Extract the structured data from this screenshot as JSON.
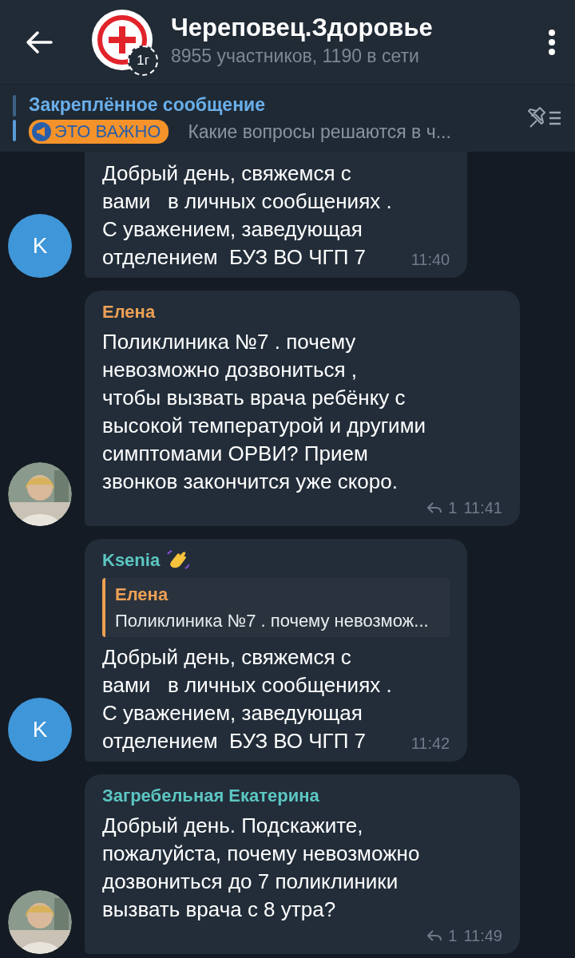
{
  "header": {
    "title": "Череповец.Здоровье",
    "subtitle": "8955 участников, 1190 в сети",
    "avatar_badge": "1г"
  },
  "pinned": {
    "label": "Закреплённое сообщение",
    "tag": "ЭТО ВАЖНО",
    "text": "Какие вопросы решаются в ч..."
  },
  "messages": [
    {
      "text": "Добрый день, свяжемся с\nвами   в личных сообщениях .\nС уважением, заведующая\nотделением  БУЗ ВО ЧГП 7",
      "time": "11:40",
      "avatar": {
        "kind": "letter",
        "letter": "K",
        "color": "#3f96d8"
      }
    },
    {
      "author": "Елена",
      "color": "#eea055",
      "text": "Поликлиника №7 . почему\nневозможно дозвониться ,\nчтобы вызвать врача ребёнку с\nвысокой температурой и другими\nсимптомами ОРВИ? Прием\nзвонков закончится уже скоро.",
      "replies": "1",
      "time": "11:41"
    },
    {
      "author": "Ksenia",
      "color": "#5cc6c2",
      "emoji_status": true,
      "quote": {
        "author": "Елена",
        "text": "Поликлиника №7 . почему невозмож...",
        "color": "#eea055"
      },
      "text": "Добрый день, свяжемся с\nвами   в личных сообщениях .\nС уважением, заведующая\nотделением  БУЗ ВО ЧГП 7",
      "time": "11:42",
      "avatar": {
        "kind": "letter",
        "letter": "K",
        "color": "#3f96d8"
      }
    },
    {
      "author": "Загребельная Екатерина",
      "color": "#5cc6c2",
      "text": "Добрый день. Подскажите,\nпожалуйста, почему невозможно\nдозвониться до 7 поликлиники\nвызвать врача с 8 утра?",
      "replies": "1",
      "time": "11:49"
    }
  ]
}
